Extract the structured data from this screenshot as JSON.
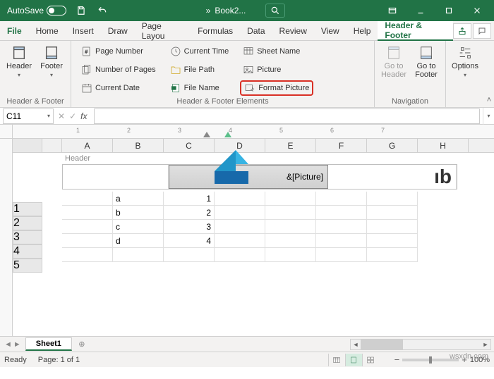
{
  "title": {
    "autosave": "AutoSave",
    "doc": "Book2..."
  },
  "tabs": {
    "file": "File",
    "home": "Home",
    "insert": "Insert",
    "draw": "Draw",
    "pagelayout": "Page Layou",
    "formulas": "Formulas",
    "data": "Data",
    "review": "Review",
    "view": "View",
    "help": "Help",
    "headerfooter": "Header & Footer"
  },
  "ribbon": {
    "group_hf": "Header & Footer",
    "header_btn": "Header",
    "footer_btn": "Footer",
    "page_number": "Page Number",
    "number_of_pages": "Number of Pages",
    "current_date": "Current Date",
    "current_time": "Current Time",
    "file_path": "File Path",
    "file_name": "File Name",
    "sheet_name": "Sheet Name",
    "picture": "Picture",
    "format_picture": "Format Picture",
    "group_elements": "Header & Footer Elements",
    "goto_header": "Go to Header",
    "goto_footer": "Go to Footer",
    "group_nav": "Navigation",
    "options": "Options"
  },
  "namebox": "C11",
  "cols": [
    "A",
    "B",
    "C",
    "D",
    "E",
    "F",
    "G",
    "H"
  ],
  "rows": [
    "1",
    "2",
    "3",
    "4",
    "5"
  ],
  "header_label": "Header",
  "header_center_text": "&[Picture]",
  "header_right_text": "ıb",
  "cells": {
    "b1": "a",
    "b2": "b",
    "b3": "c",
    "b4": "d",
    "c1": "1",
    "c2": "2",
    "c3": "3",
    "c4": "4"
  },
  "sheet": "Sheet1",
  "status": {
    "ready": "Ready",
    "page": "Page: 1 of 1",
    "zoom": "100%"
  },
  "watermark": "wsxdn.com",
  "ruler_ticks": [
    "1",
    "2",
    "3",
    "4",
    "5",
    "6",
    "7"
  ]
}
